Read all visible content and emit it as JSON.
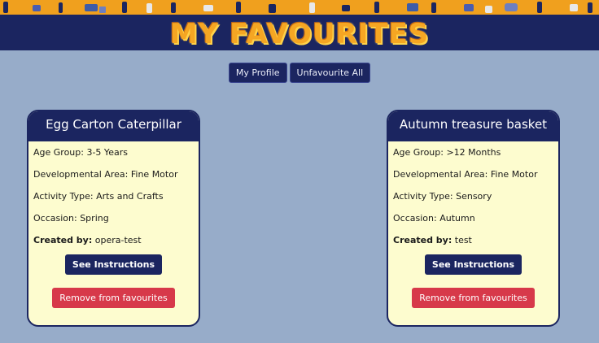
{
  "header": {
    "title": "MY FAVOURITES"
  },
  "nav": {
    "profile_label": "My Profile",
    "unfavourite_all_label": "Unfavourite All"
  },
  "labels": {
    "age_group": "Age Group:",
    "dev_area": "Developmental Area:",
    "activity_type": "Activity Type:",
    "occasion": "Occasion:",
    "created_by": "Created by:",
    "see_instructions": "See Instructions",
    "remove": "Remove from favourites"
  },
  "cards": [
    {
      "title": "Egg Carton Caterpillar",
      "age_group": "3-5 Years",
      "dev_area": "Fine Motor",
      "activity_type": "Arts and Crafts",
      "occasion": "Spring",
      "created_by": "opera-test"
    },
    {
      "title": "Autumn treasure basket",
      "age_group": ">12 Months",
      "dev_area": "Fine Motor",
      "activity_type": "Sensory",
      "occasion": "Autumn",
      "created_by": "test"
    }
  ],
  "colors": {
    "background": "#97acc9",
    "navy": "#1b2560",
    "banner_orange": "#f0a01e",
    "card_bg": "#fdfccf",
    "remove_red": "#d7394a"
  }
}
